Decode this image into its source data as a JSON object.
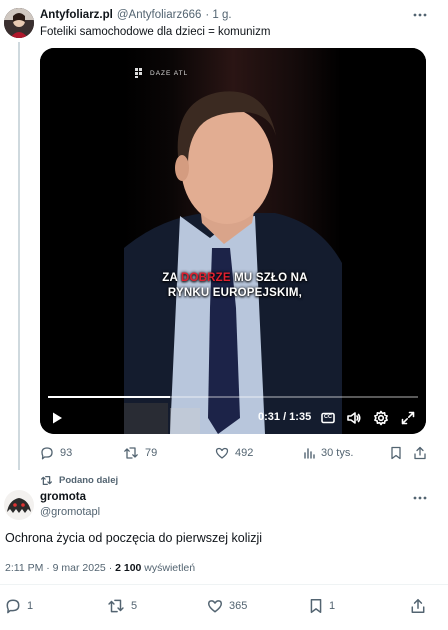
{
  "quoted_tweet": {
    "display_name": "Antyfoliarz.pl",
    "handle": "@Antyfoliarz666",
    "time": "· 1 g.",
    "text": "Foteliki samochodowe dla dzieci = komunizm",
    "video": {
      "watermark": "DAZE ATL",
      "caption": {
        "before": "ZA ",
        "highlight": "DOBRZE",
        "after": " MU SZŁO NA",
        "line2": "RYNKU EUROPEJSKIM,"
      },
      "time_display": "0:31 / 1:35",
      "cc_label": "CC",
      "progress": 0.33
    },
    "stats": {
      "replies": "93",
      "retweets": "79",
      "likes": "492",
      "views": "30 tys."
    }
  },
  "repost_label": "Podano dalej",
  "reply_tweet": {
    "display_name": "gromota",
    "handle": "@gromotapl",
    "text": "Ochrona życia od poczęcia do pierwszej kolizji",
    "meta_time": "2:11 PM · 9 mar 2025 · ",
    "meta_views_count": "2 100",
    "meta_views_label": " wyświetleń",
    "stats": {
      "replies": "1",
      "retweets": "5",
      "likes": "365",
      "bookmarks": "1"
    }
  },
  "colors": {
    "accent": "#1d9bf0",
    "muted": "#536471",
    "highlight": "#e0202f"
  }
}
